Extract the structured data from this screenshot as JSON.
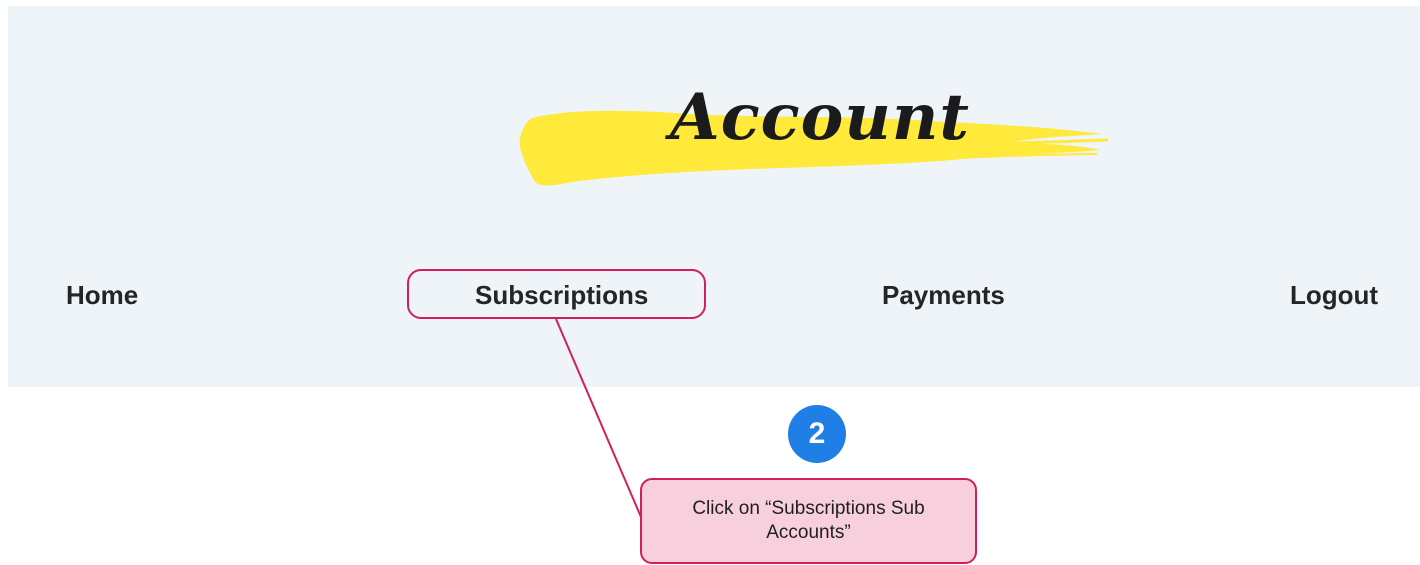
{
  "header": {
    "title": "Account",
    "brush_color": "#ffe93b",
    "background_color": "#eff4f9"
  },
  "nav": {
    "items": [
      {
        "label": "Home"
      },
      {
        "label": "Subscriptions"
      },
      {
        "label": "Payments"
      },
      {
        "label": "Logout"
      }
    ]
  },
  "annotation": {
    "step_number": "2",
    "step_color": "#1f7fe6",
    "highlight_color": "#d11f5b",
    "callout_text": "Click on “Subscriptions Sub Accounts”",
    "callout_background": "#f7cfdd"
  }
}
